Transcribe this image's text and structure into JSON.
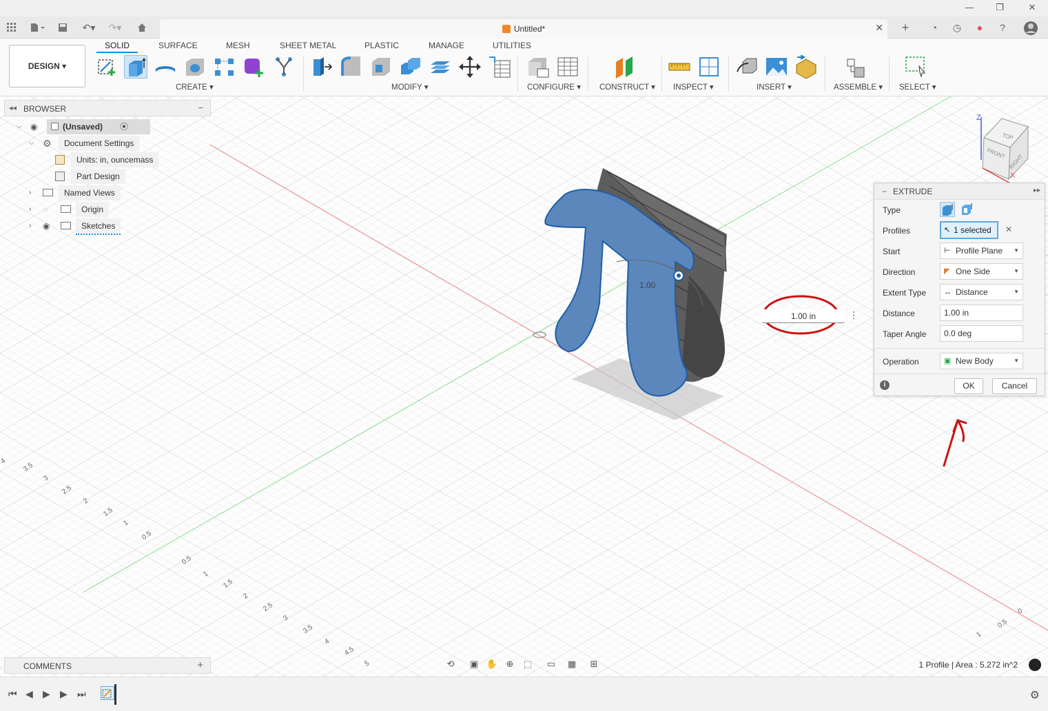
{
  "app": {
    "doc_title": "Untitled*",
    "workspace_button": "DESIGN ▾"
  },
  "toolbar": {
    "tabs": [
      "SOLID",
      "SURFACE",
      "MESH",
      "SHEET METAL",
      "PLASTIC",
      "MANAGE",
      "UTILITIES"
    ],
    "groups": {
      "create": "CREATE ▾",
      "modify": "MODIFY ▾",
      "configure": "CONFIGURE ▾",
      "construct": "CONSTRUCT ▾",
      "inspect": "INSPECT ▾",
      "insert": "INSERT ▾",
      "assemble": "ASSEMBLE ▾",
      "select": "SELECT ▾"
    },
    "accent": "#0696d7"
  },
  "browser": {
    "title": "BROWSER",
    "collapse": "−",
    "root": "(Unsaved)",
    "items": [
      {
        "label": "Document Settings"
      },
      {
        "label": "Units: in, ouncemass"
      },
      {
        "label": "Part Design"
      },
      {
        "label": "Named Views"
      },
      {
        "label": "Origin"
      },
      {
        "label": "Sketches"
      }
    ]
  },
  "viewport": {
    "dimension_input": "1.00 in",
    "dimension_label": "1.00",
    "viewcube": {
      "top": "TOP",
      "front": "FRONT",
      "right": "RIGHT",
      "z": "Z",
      "x": "X"
    },
    "axis_ticks_left": [
      "4",
      "3.5",
      "3",
      "2.5",
      "2",
      "1.5",
      "1",
      "0.5"
    ],
    "axis_ticks_bottom": [
      "0.5",
      "1",
      "1.5",
      "2",
      "2.5",
      "3",
      "3.5",
      "4",
      "4.5",
      "5"
    ],
    "axis_ticks_right": [
      "0",
      "0.5",
      "1"
    ]
  },
  "extrude": {
    "title": "EXTRUDE",
    "rows": {
      "type": "Type",
      "profiles": "Profiles",
      "start": "Start",
      "direction": "Direction",
      "extent_type": "Extent Type",
      "distance": "Distance",
      "taper_angle": "Taper Angle",
      "operation": "Operation"
    },
    "values": {
      "profiles": "1 selected",
      "start": "Profile Plane",
      "direction": "One Side",
      "extent_type": "Distance",
      "distance": "1.00 in",
      "taper_angle": "0.0 deg",
      "operation": "New Body"
    },
    "ok": "OK",
    "cancel": "Cancel"
  },
  "bottom": {
    "comments": "COMMENTS",
    "comments_add": "+",
    "status": "1 Profile | Area : 5.272 in^2"
  }
}
